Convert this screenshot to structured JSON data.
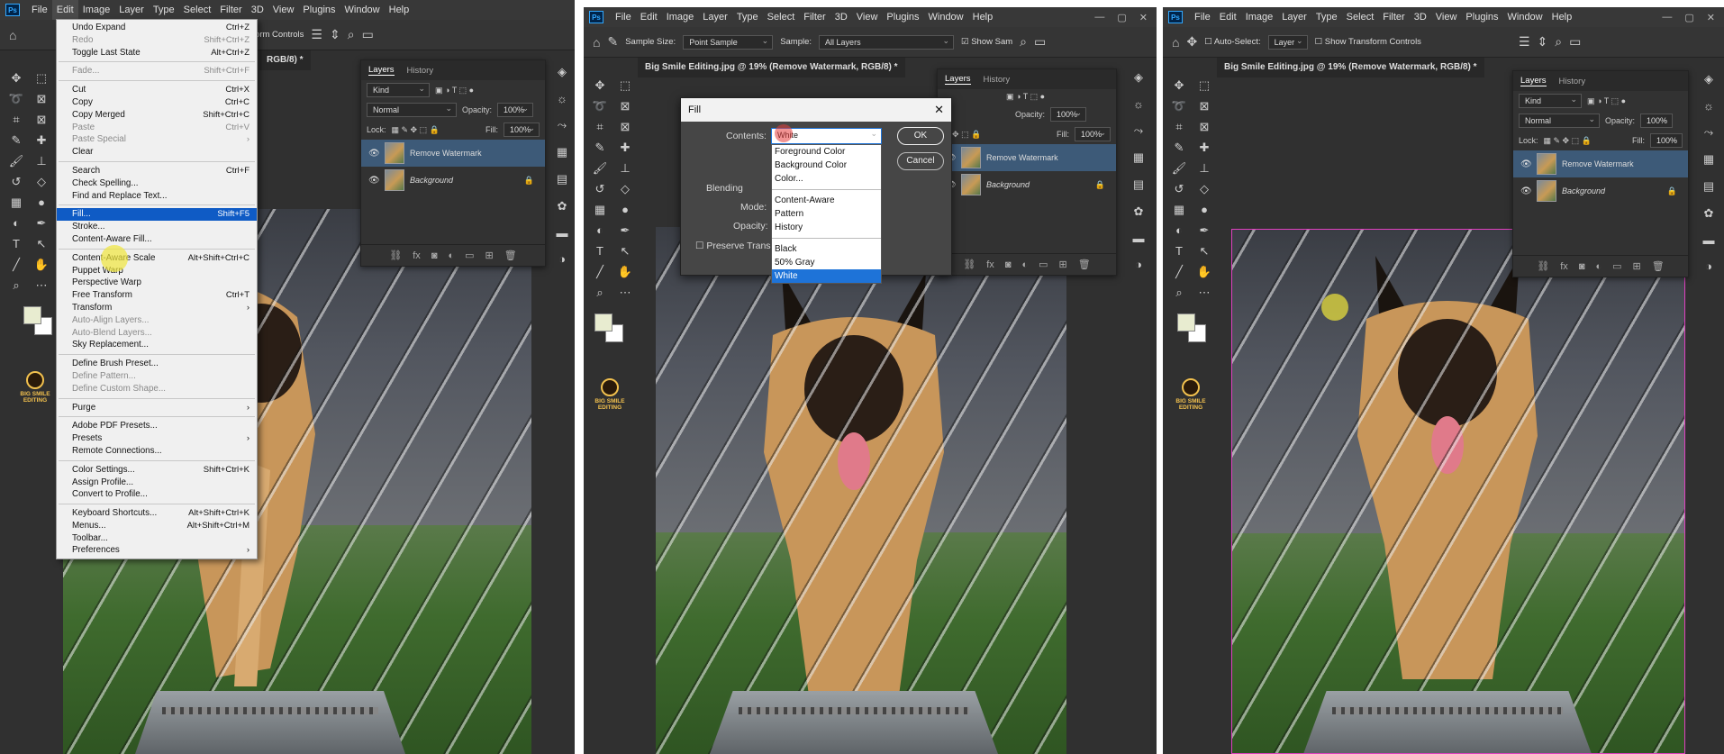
{
  "menus": [
    "File",
    "Edit",
    "Image",
    "Layer",
    "Type",
    "Select",
    "Filter",
    "3D",
    "View",
    "Plugins",
    "Window",
    "Help"
  ],
  "ps_logo": "Ps",
  "panel1": {
    "opt_text": "Transform Controls",
    "doc_tab": "",
    "edit_menu": [
      {
        "label": "Undo Expand",
        "sc": "Ctrl+Z",
        "dis": false
      },
      {
        "label": "Redo",
        "sc": "Shift+Ctrl+Z",
        "dis": true
      },
      {
        "label": "Toggle Last State",
        "sc": "Alt+Ctrl+Z",
        "dis": false
      },
      {
        "sep": true
      },
      {
        "label": "Fade...",
        "sc": "Shift+Ctrl+F",
        "dis": true
      },
      {
        "sep": true
      },
      {
        "label": "Cut",
        "sc": "Ctrl+X",
        "dis": false
      },
      {
        "label": "Copy",
        "sc": "Ctrl+C",
        "dis": false
      },
      {
        "label": "Copy Merged",
        "sc": "Shift+Ctrl+C",
        "dis": false
      },
      {
        "label": "Paste",
        "sc": "Ctrl+V",
        "dis": true
      },
      {
        "label": "Paste Special",
        "sc": "›",
        "dis": true
      },
      {
        "label": "Clear",
        "sc": "",
        "dis": false
      },
      {
        "sep": true
      },
      {
        "label": "Search",
        "sc": "Ctrl+F",
        "dis": false
      },
      {
        "label": "Check Spelling...",
        "sc": "",
        "dis": false
      },
      {
        "label": "Find and Replace Text...",
        "sc": "",
        "dis": false
      },
      {
        "sep": true
      },
      {
        "label": "Fill...",
        "sc": "Shift+F5",
        "dis": false,
        "hl": true
      },
      {
        "label": "Stroke...",
        "sc": "",
        "dis": false
      },
      {
        "label": "Content-Aware Fill...",
        "sc": "",
        "dis": false
      },
      {
        "sep": true
      },
      {
        "label": "Content-Aware Scale",
        "sc": "Alt+Shift+Ctrl+C",
        "dis": false
      },
      {
        "label": "Puppet Warp",
        "sc": "",
        "dis": false
      },
      {
        "label": "Perspective Warp",
        "sc": "",
        "dis": false
      },
      {
        "label": "Free Transform",
        "sc": "Ctrl+T",
        "dis": false
      },
      {
        "label": "Transform",
        "sc": "›",
        "dis": false
      },
      {
        "label": "Auto-Align Layers...",
        "sc": "",
        "dis": true
      },
      {
        "label": "Auto-Blend Layers...",
        "sc": "",
        "dis": true
      },
      {
        "label": "Sky Replacement...",
        "sc": "",
        "dis": false
      },
      {
        "sep": true
      },
      {
        "label": "Define Brush Preset...",
        "sc": "",
        "dis": false
      },
      {
        "label": "Define Pattern...",
        "sc": "",
        "dis": true
      },
      {
        "label": "Define Custom Shape...",
        "sc": "",
        "dis": true
      },
      {
        "sep": true
      },
      {
        "label": "Purge",
        "sc": "›",
        "dis": false
      },
      {
        "sep": true
      },
      {
        "label": "Adobe PDF Presets...",
        "sc": "",
        "dis": false
      },
      {
        "label": "Presets",
        "sc": "›",
        "dis": false
      },
      {
        "label": "Remote Connections...",
        "sc": "",
        "dis": false
      },
      {
        "sep": true
      },
      {
        "label": "Color Settings...",
        "sc": "Shift+Ctrl+K",
        "dis": false
      },
      {
        "label": "Assign Profile...",
        "sc": "",
        "dis": false
      },
      {
        "label": "Convert to Profile...",
        "sc": "",
        "dis": false
      },
      {
        "sep": true
      },
      {
        "label": "Keyboard Shortcuts...",
        "sc": "Alt+Shift+Ctrl+K",
        "dis": false
      },
      {
        "label": "Menus...",
        "sc": "Alt+Shift+Ctrl+M",
        "dis": false
      },
      {
        "label": "Toolbar...",
        "sc": "",
        "dis": false
      },
      {
        "label": "Preferences",
        "sc": "›",
        "dis": false
      }
    ],
    "doc_partial": "RGB/8) *"
  },
  "panel2": {
    "sample_size_label": "Sample Size:",
    "sample_size": "Point Sample",
    "sample_label": "Sample:",
    "sample": "All Layers",
    "show_ring": "Show Sam",
    "doc_tab": "Big Smile Editing.jpg @ 19% (Remove Watermark, RGB/8) *",
    "fill": {
      "title": "Fill",
      "contents_label": "Contents:",
      "contents_value": "White",
      "ok": "OK",
      "cancel": "Cancel",
      "blending_label": "Blending",
      "mode_label": "Mode:",
      "opacity_label": "Opacity:",
      "preserve_label": "Preserve Trans",
      "options_g1": [
        "Foreground Color",
        "Background Color",
        "Color..."
      ],
      "options_g2": [
        "Content-Aware",
        "Pattern",
        "History"
      ],
      "options_g3": [
        "Black",
        "50% Gray",
        "White"
      ]
    }
  },
  "panel3": {
    "auto_select": "Auto-Select:",
    "layer_sel": "Layer",
    "show_transform": "Show Transform Controls",
    "doc_tab": "Big Smile Editing.jpg @ 19% (Remove Watermark, RGB/8) *"
  },
  "layers_panel": {
    "tab_layers": "Layers",
    "tab_history": "History",
    "kind": "Kind",
    "blend": "Normal",
    "opacity_label": "Opacity:",
    "opacity": "100%",
    "lock_label": "Lock:",
    "fill_label": "Fill:",
    "fill": "100%",
    "layer1": "Remove Watermark",
    "layer2": "Background"
  },
  "logo_text": "BIG SMILE EDITING"
}
